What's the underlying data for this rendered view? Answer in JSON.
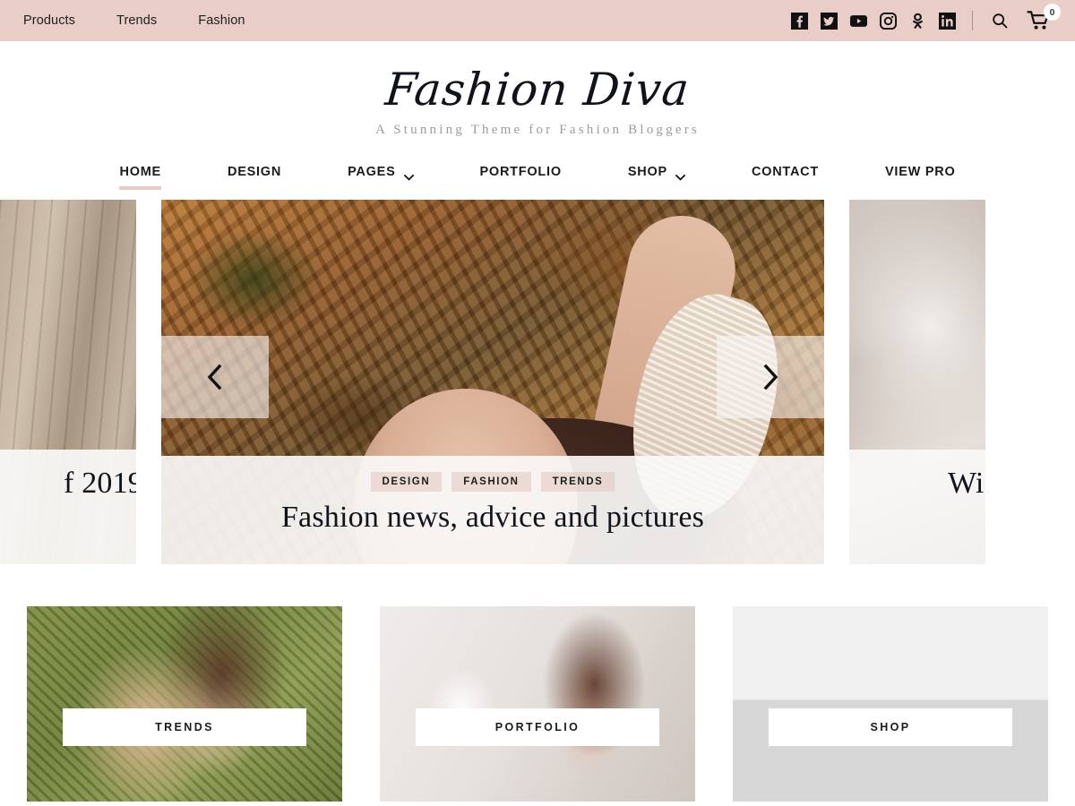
{
  "topbar": {
    "nav": [
      {
        "label": "Products"
      },
      {
        "label": "Trends"
      },
      {
        "label": "Fashion"
      }
    ],
    "social": [
      {
        "name": "facebook-icon"
      },
      {
        "name": "twitter-icon"
      },
      {
        "name": "youtube-icon"
      },
      {
        "name": "instagram-icon"
      },
      {
        "name": "odnoklassniki-icon"
      },
      {
        "name": "linkedin-icon"
      }
    ],
    "search_label": "Search",
    "cart_count": "0",
    "background_color": "#e8cec7"
  },
  "branding": {
    "site_title": "Fashion Diva",
    "tagline": "A Stunning Theme for Fashion Bloggers"
  },
  "mainnav": {
    "accent_color": "#e5ccc4",
    "items": [
      {
        "label": "HOME",
        "active": true,
        "has_dropdown": false
      },
      {
        "label": "DESIGN",
        "active": false,
        "has_dropdown": false
      },
      {
        "label": "PAGES",
        "active": false,
        "has_dropdown": true
      },
      {
        "label": "PORTFOLIO",
        "active": false,
        "has_dropdown": false
      },
      {
        "label": "SHOP",
        "active": false,
        "has_dropdown": true
      },
      {
        "label": "CONTACT",
        "active": false,
        "has_dropdown": false
      },
      {
        "label": "VIEW PRO",
        "active": false,
        "has_dropdown": false
      }
    ]
  },
  "slider": {
    "prev_label": "Previous slide",
    "next_label": "Next slide",
    "slides": [
      {
        "position": "left",
        "title": "f 2019",
        "image": "wooden-floor-photo"
      },
      {
        "position": "center",
        "title": "Fashion news, advice and pictures",
        "image": "autumn-leaves-portrait-photo",
        "categories": [
          "DESIGN",
          "FASHION",
          "TRENDS"
        ]
      },
      {
        "position": "right",
        "title": "Wi",
        "image": "winter-fashion-photo"
      }
    ]
  },
  "cards": [
    {
      "label": "TRENDS",
      "image": "two-women-on-grass-photo"
    },
    {
      "label": "PORTFOLIO",
      "image": "lingerie-model-photo"
    },
    {
      "label": "SHOP",
      "image": "group-of-shoppers-photo"
    }
  ]
}
